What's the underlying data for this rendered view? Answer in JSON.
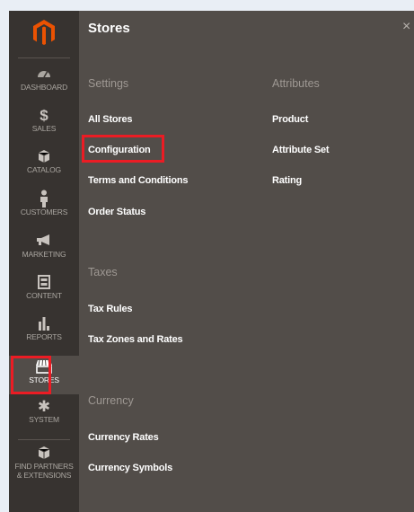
{
  "sidebar": {
    "items": [
      {
        "label": "DASHBOARD",
        "icon": "dashboard-icon"
      },
      {
        "label": "SALES",
        "icon": "dollar-icon"
      },
      {
        "label": "CATALOG",
        "icon": "box-icon"
      },
      {
        "label": "CUSTOMERS",
        "icon": "person-icon"
      },
      {
        "label": "MARKETING",
        "icon": "megaphone-icon"
      },
      {
        "label": "CONTENT",
        "icon": "layout-icon"
      },
      {
        "label": "REPORTS",
        "icon": "bar-chart-icon"
      },
      {
        "label": "STORES",
        "icon": "storefront-icon",
        "active": true
      },
      {
        "label": "SYSTEM",
        "icon": "gear-icon"
      },
      {
        "label": "FIND PARTNERS",
        "label2": "& EXTENSIONS",
        "icon": "cube-icon"
      }
    ]
  },
  "panel": {
    "title": "Stores",
    "close_glyph": "×",
    "settings": {
      "title": "Settings",
      "links": [
        "All Stores",
        "Configuration",
        "Terms and Conditions",
        "Order Status"
      ]
    },
    "attributes": {
      "title": "Attributes",
      "links": [
        "Product",
        "Attribute Set",
        "Rating"
      ]
    },
    "taxes": {
      "title": "Taxes",
      "links": [
        "Tax Rules",
        "Tax Zones and Rates"
      ]
    },
    "currency": {
      "title": "Currency",
      "links": [
        "Currency Rates",
        "Currency Symbols"
      ]
    }
  },
  "highlights": [
    "Configuration",
    "STORES"
  ],
  "colors": {
    "sidebar": "#373330",
    "panel": "#524d49",
    "highlight": "#eb1c24",
    "brand": "#eb5202"
  }
}
